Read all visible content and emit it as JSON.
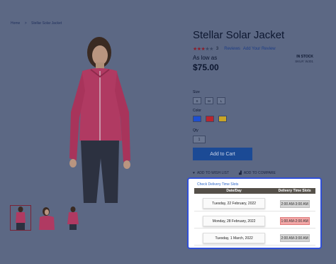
{
  "breadcrumb": {
    "home": "Home",
    "separator": ">",
    "current": "Stellar Solar Jacket"
  },
  "product": {
    "title": "Stellar Solar Jacket",
    "rating_stars_filled": 3,
    "rating_stars_total": 5,
    "rating_text": "3",
    "reviews_link": "Reviews",
    "add_review_link": "Add Your Review",
    "as_low_as": "As low as",
    "price": "$75.00",
    "stock": "IN STOCK",
    "sku": "SKU#:  WJ01"
  },
  "options": {
    "size_label": "Size",
    "sizes": [
      "S",
      "M",
      "L"
    ],
    "color_label": "Color",
    "colors": [
      "#1d4fd0",
      "#b8252e",
      "#c9a526"
    ],
    "qty_label": "Qty",
    "qty_value": "1"
  },
  "actions": {
    "add_to_cart": "Add to Cart",
    "wishlist": "ADD TO WISH LIST",
    "compare": "ADD TO COMPARE"
  },
  "delivery": {
    "link": "Check Delivery Time Slots",
    "headers": [
      "Date/Day",
      "Delivery Time Slots"
    ],
    "rows": [
      {
        "date": "Tuesday, 22 February, 2022",
        "slot": "2:00 AM-3:00 AM",
        "status": "available"
      },
      {
        "date": "Monday, 28 February, 2022",
        "slot": "1:00 AM-2:00 AM",
        "status": "booked"
      },
      {
        "date": "Tuesday, 1 March, 2022",
        "slot": "2:00 AM-3:00 AM",
        "status": "available"
      }
    ]
  },
  "colors": {
    "overlay": "#5c6884",
    "highlight_border": "#2f4fd8",
    "primary_button": "#1b4a95",
    "table_header": "#555049",
    "slot_booked": "#f2a6a6"
  }
}
